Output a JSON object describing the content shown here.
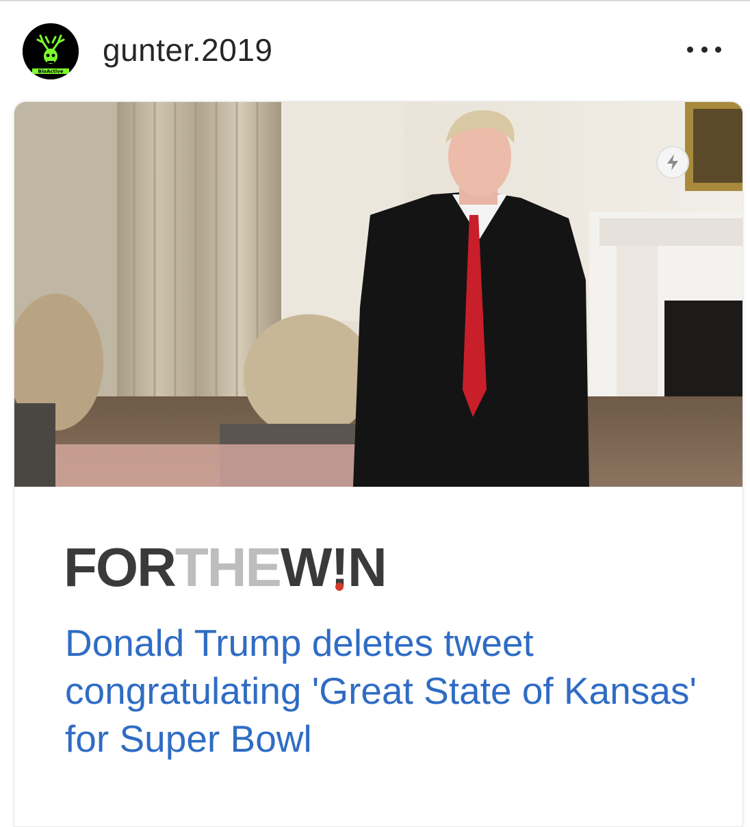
{
  "post": {
    "username": "gunter.2019",
    "avatar_icon": "skull-antlers-logo",
    "avatar_text": "BioActive",
    "more_icon": "more-options-icon"
  },
  "card": {
    "badge_icon": "lightning-bolt-icon",
    "publisher": {
      "part1": "FOR",
      "part2": "THE",
      "part3": "W",
      "bang": "!",
      "part4": "N"
    },
    "headline": "Donald Trump deletes tweet congratulating 'Great State of Kansas' for Super Bowl"
  },
  "colors": {
    "headline": "#2f6cc4",
    "publisher_dark": "#3a3a3a",
    "publisher_light": "#bdbdbd",
    "publisher_dot": "#d33a2c",
    "avatar_green": "#7cff2a"
  }
}
